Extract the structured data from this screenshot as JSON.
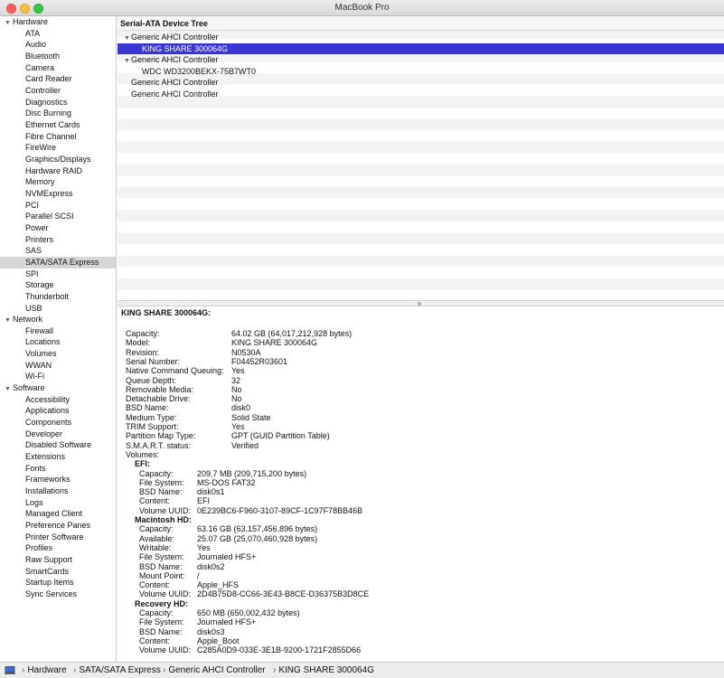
{
  "window": {
    "title": "MacBook Pro"
  },
  "sidebar": {
    "sections": [
      {
        "label": "Hardware",
        "items": [
          "ATA",
          "Audio",
          "Bluetooth",
          "Camera",
          "Card Reader",
          "Controller",
          "Diagnostics",
          "Disc Burning",
          "Ethernet Cards",
          "Fibre Channel",
          "FireWire",
          "Graphics/Displays",
          "Hardware RAID",
          "Memory",
          "NVMExpress",
          "PCI",
          "Parallel SCSI",
          "Power",
          "Printers",
          "SAS",
          "SATA/SATA Express",
          "SPI",
          "Storage",
          "Thunderbolt",
          "USB"
        ]
      },
      {
        "label": "Network",
        "items": [
          "Firewall",
          "Locations",
          "Volumes",
          "WWAN",
          "Wi-Fi"
        ]
      },
      {
        "label": "Software",
        "items": [
          "Accessibility",
          "Applications",
          "Components",
          "Developer",
          "Disabled Software",
          "Extensions",
          "Fonts",
          "Frameworks",
          "Installations",
          "Logs",
          "Managed Client",
          "Preference Panes",
          "Printer Software",
          "Profiles",
          "Raw Support",
          "SmartCards",
          "Startup Items",
          "Sync Services"
        ]
      }
    ],
    "selected": "SATA/SATA Express"
  },
  "tree": {
    "header": "Serial-ATA Device Tree",
    "rows": [
      {
        "label": "Generic AHCI Controller",
        "level": 0,
        "expanded": true
      },
      {
        "label": "KING SHARE 300064G",
        "level": 1,
        "selected": true
      },
      {
        "label": "Generic AHCI Controller",
        "level": 0,
        "expanded": true
      },
      {
        "label": "WDC WD3200BEKX-75B7WT0",
        "level": 1
      },
      {
        "label": "Generic AHCI Controller",
        "level": 0
      },
      {
        "label": "Generic AHCI Controller",
        "level": 0
      }
    ]
  },
  "detail": {
    "title": "KING SHARE 300064G:",
    "properties": [
      {
        "key": "Capacity:",
        "value": "64.02 GB (64,017,212,928 bytes)"
      },
      {
        "key": "Model:",
        "value": "KING SHARE 300064G"
      },
      {
        "key": "Revision:",
        "value": "N0530A"
      },
      {
        "key": "Serial Number:",
        "value": "F04452R03601"
      },
      {
        "key": "Native Command Queuing:",
        "value": "Yes"
      },
      {
        "key": "Queue Depth:",
        "value": "32"
      },
      {
        "key": "Removable Media:",
        "value": "No"
      },
      {
        "key": "Detachable Drive:",
        "value": "No"
      },
      {
        "key": "BSD Name:",
        "value": "disk0"
      },
      {
        "key": "Medium Type:",
        "value": "Solid State"
      },
      {
        "key": "TRIM Support:",
        "value": "Yes"
      },
      {
        "key": "Partition Map Type:",
        "value": "GPT (GUID Partition Table)"
      },
      {
        "key": "S.M.A.R.T. status:",
        "value": "Verified"
      }
    ],
    "volumes_label": "Volumes:",
    "volumes": [
      {
        "name": "EFI:",
        "properties": [
          {
            "key": "Capacity:",
            "value": "209.7 MB (209,715,200 bytes)"
          },
          {
            "key": "File System:",
            "value": "MS-DOS FAT32"
          },
          {
            "key": "BSD Name:",
            "value": "disk0s1"
          },
          {
            "key": "Content:",
            "value": "EFI"
          },
          {
            "key": "Volume UUID:",
            "value": "0E239BC6-F960-3107-89CF-1C97F78BB46B"
          }
        ]
      },
      {
        "name": "Macintosh HD:",
        "properties": [
          {
            "key": "Capacity:",
            "value": "63.16 GB (63,157,456,896 bytes)"
          },
          {
            "key": "Available:",
            "value": "25.07 GB (25,070,460,928 bytes)"
          },
          {
            "key": "Writable:",
            "value": "Yes"
          },
          {
            "key": "File System:",
            "value": "Journaled HFS+"
          },
          {
            "key": "BSD Name:",
            "value": "disk0s2"
          },
          {
            "key": "Mount Point:",
            "value": "/"
          },
          {
            "key": "Content:",
            "value": "Apple_HFS"
          },
          {
            "key": "Volume UUID:",
            "value": "2D4B75D8-CC66-3E43-B8CE-D36375B3D8CE"
          }
        ]
      },
      {
        "name": "Recovery HD:",
        "properties": [
          {
            "key": "Capacity:",
            "value": "650 MB (650,002,432 bytes)"
          },
          {
            "key": "File System:",
            "value": "Journaled HFS+"
          },
          {
            "key": "BSD Name:",
            "value": "disk0s3"
          },
          {
            "key": "Content:",
            "value": "Apple_Boot"
          },
          {
            "key": "Volume UUID:",
            "value": "C285A0D9-033E-3E1B-9200-1721F2855D66"
          }
        ]
      }
    ]
  },
  "pathbar": {
    "icon": "computer-icon",
    "crumbs": [
      "Hardware",
      "SATA/SATA Express",
      "Generic AHCI Controller",
      "KING SHARE 300064G"
    ],
    "separator": "›"
  },
  "colors": {
    "selection": "#3a36d4",
    "sidebar_selection": "#d6d6d6"
  }
}
